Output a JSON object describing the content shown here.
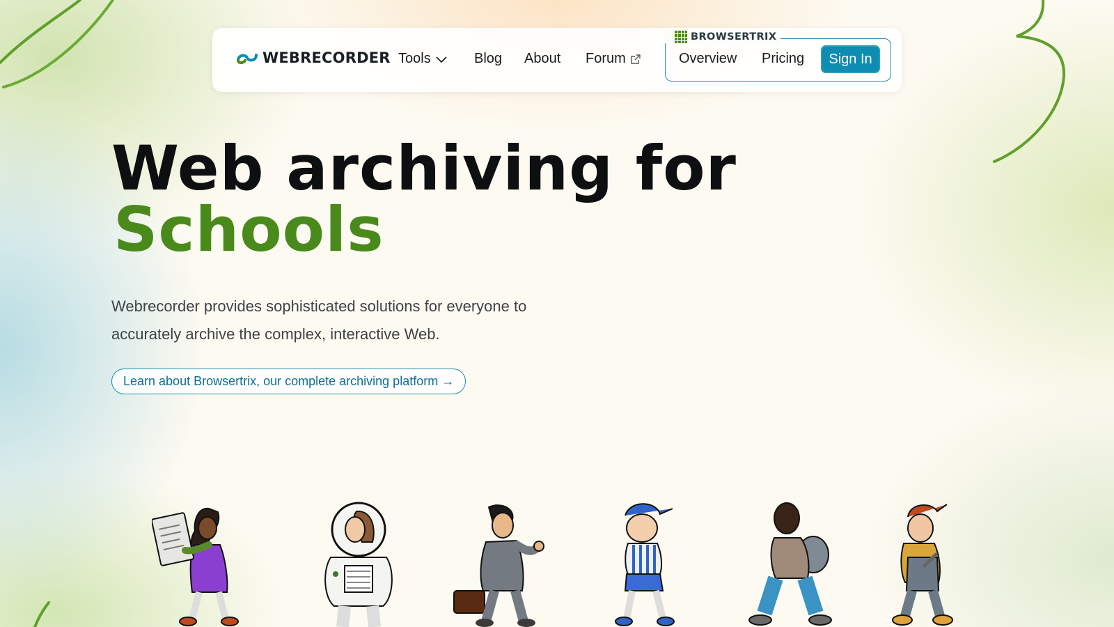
{
  "nav": {
    "brand": "WEBRECORDER",
    "tools": "Tools",
    "blog": "Blog",
    "about": "About",
    "forum": "Forum",
    "browsertrix_label": "BROWSERTRIX",
    "overview": "Overview",
    "pricing": "Pricing",
    "sign_in": "Sign In"
  },
  "hero": {
    "title_line1": "Web archiving for",
    "title_line2": "Schools",
    "description": "Webrecorder provides sophisticated solutions for everyone to accurately archive the complex, interactive Web.",
    "cta": "Learn about Browsertrix, our complete archiving platform →"
  },
  "colors": {
    "accent": "#0d8db1",
    "green": "#4a8a1c",
    "text": "#0e0f10"
  },
  "icons": [
    "webrecorder-logo-icon",
    "chevron-down-icon",
    "external-link-icon",
    "browsertrix-grid-icon"
  ]
}
